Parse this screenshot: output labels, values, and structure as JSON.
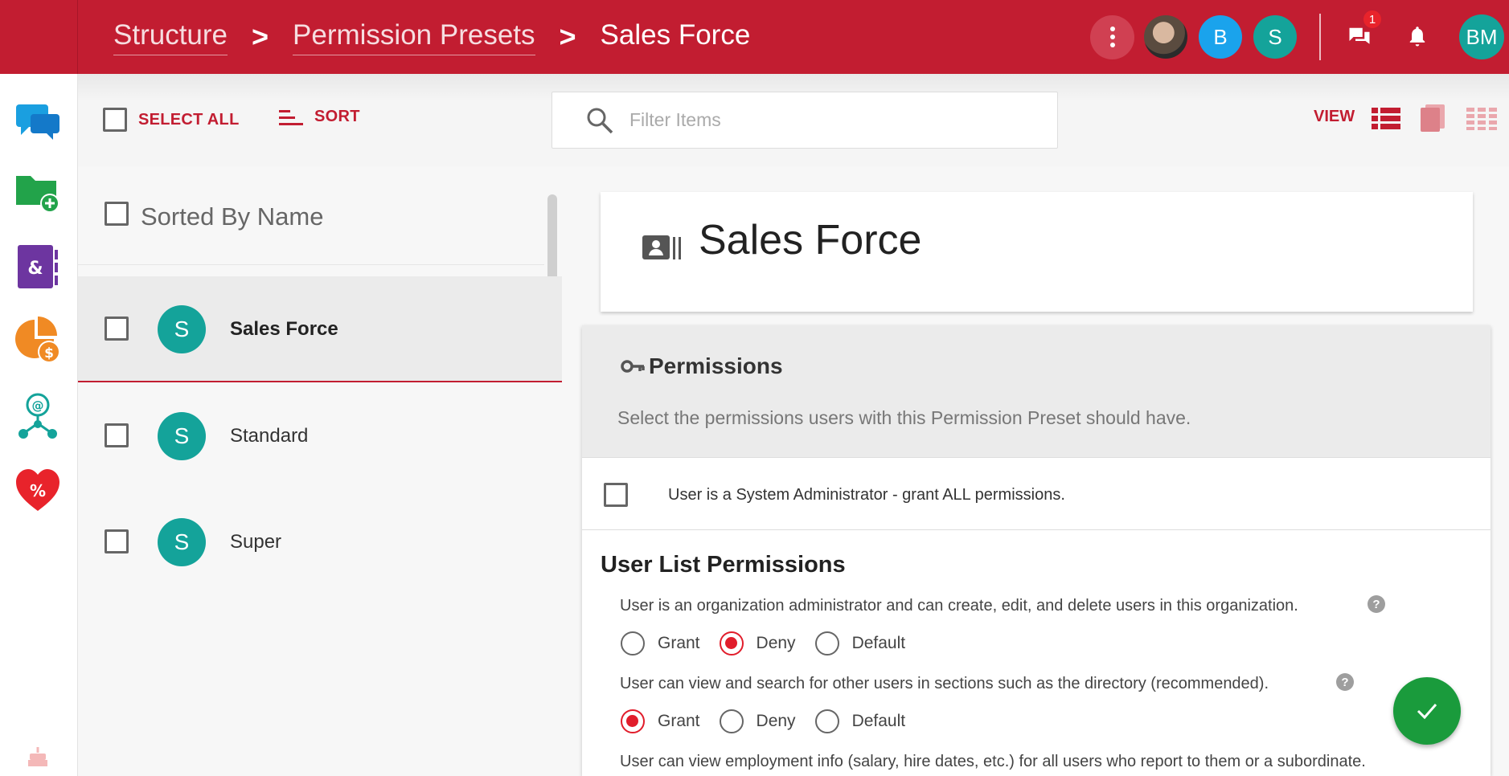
{
  "breadcrumb": {
    "items": [
      "Structure",
      "Permission Presets"
    ],
    "separator": ">",
    "current": "Sales Force"
  },
  "header": {
    "avatars": [
      "B",
      "S"
    ],
    "user_initials": "BM",
    "chat_badge_count": "1",
    "colors": {
      "brand": "#c21d31",
      "avatar_blue": "#1aa3ec",
      "avatar_teal": "#14a39a"
    }
  },
  "rail": {
    "icons": [
      "chat-icon",
      "folder-add-icon",
      "contacts-book-icon",
      "pie-chart-dollar-icon",
      "network-icon",
      "heart-percent-icon",
      "cake-icon"
    ]
  },
  "toolbar": {
    "select_all_label": "SELECT ALL",
    "sort_label": "SORT",
    "search_placeholder": "Filter Items",
    "view_label": "VIEW"
  },
  "list": {
    "header_label": "Sorted By Name",
    "items": [
      {
        "initial": "S",
        "name": "Sales Force",
        "selected": true
      },
      {
        "initial": "S",
        "name": "Standard",
        "selected": false
      },
      {
        "initial": "S",
        "name": "Super",
        "selected": false
      }
    ]
  },
  "detail": {
    "title": "Sales Force",
    "permissions": {
      "title": "Permissions",
      "description": "Select the permissions users with this Permission Preset should have.",
      "admin_label": "User is a System Administrator - grant ALL permissions.",
      "section_title": "User List Permissions",
      "questions": [
        {
          "text": "User is an organization administrator and can create, edit, and delete users in this organization.",
          "selected": "Deny"
        },
        {
          "text": "User can view and search for other users in sections such as the directory (recommended).",
          "selected": "Grant"
        },
        {
          "text": "User can view employment info (salary, hire dates, etc.) for all users who report to them or a subordinate.",
          "selected": ""
        }
      ],
      "options": [
        "Grant",
        "Deny",
        "Default"
      ],
      "help_glyph": "?"
    }
  }
}
